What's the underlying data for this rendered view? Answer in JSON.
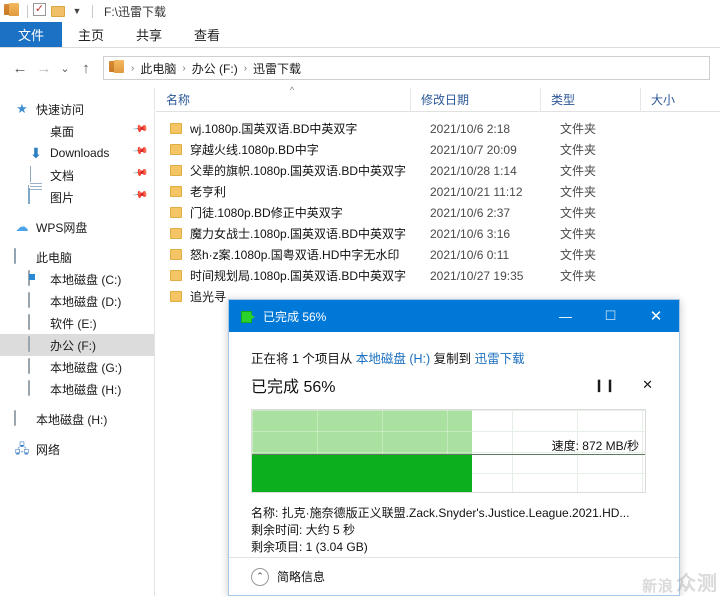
{
  "window": {
    "quick_access_icons": [
      "explorer-icon",
      "check-icon",
      "folder-icon",
      "dropdown-caret-icon"
    ],
    "title_path": "F:\\迅雷下载"
  },
  "ribbon": {
    "tabs": [
      {
        "label": "文件",
        "active": true
      },
      {
        "label": "主页",
        "active": false
      },
      {
        "label": "共享",
        "active": false
      },
      {
        "label": "查看",
        "active": false
      }
    ]
  },
  "address_bar": {
    "back_label": "←",
    "forward_label": "→",
    "history_label": "⌄",
    "up_label": "↑",
    "crumbs": [
      "此电脑",
      "办公 (F:)",
      "迅雷下载"
    ],
    "separator": "›"
  },
  "sidebar": {
    "items": [
      {
        "label": "快速访问",
        "icon": "star-icon",
        "level": 0,
        "pinned": false,
        "selected": false
      },
      {
        "label": "桌面",
        "icon": "desktop-icon",
        "level": 1,
        "pinned": true,
        "selected": false
      },
      {
        "label": "Downloads",
        "icon": "download-icon",
        "level": 1,
        "pinned": true,
        "selected": false
      },
      {
        "label": "文档",
        "icon": "document-icon",
        "level": 1,
        "pinned": true,
        "selected": false
      },
      {
        "label": "图片",
        "icon": "pictures-icon",
        "level": 1,
        "pinned": true,
        "selected": false
      },
      {
        "label": "WPS网盘",
        "icon": "cloud-icon",
        "level": 0,
        "pinned": false,
        "selected": false
      },
      {
        "label": "此电脑",
        "icon": "computer-icon",
        "level": 0,
        "pinned": false,
        "selected": false
      },
      {
        "label": "本地磁盘 (C:)",
        "icon": "windows-drive-icon",
        "level": 1,
        "pinned": false,
        "selected": false
      },
      {
        "label": "本地磁盘 (D:)",
        "icon": "drive-icon",
        "level": 1,
        "pinned": false,
        "selected": false
      },
      {
        "label": "软件 (E:)",
        "icon": "drive-icon",
        "level": 1,
        "pinned": false,
        "selected": false
      },
      {
        "label": "办公 (F:)",
        "icon": "drive-icon",
        "level": 1,
        "pinned": false,
        "selected": true
      },
      {
        "label": "本地磁盘 (G:)",
        "icon": "drive-icon",
        "level": 1,
        "pinned": false,
        "selected": false
      },
      {
        "label": "本地磁盘 (H:)",
        "icon": "drive-icon",
        "level": 1,
        "pinned": false,
        "selected": false
      },
      {
        "label": "本地磁盘 (H:)",
        "icon": "drive-icon",
        "level": 2,
        "pinned": false,
        "selected": false
      },
      {
        "label": "网络",
        "icon": "network-icon",
        "level": 2,
        "pinned": false,
        "selected": false
      }
    ]
  },
  "file_list": {
    "columns": [
      {
        "key": "name",
        "label": "名称"
      },
      {
        "key": "date",
        "label": "修改日期"
      },
      {
        "key": "type",
        "label": "类型"
      },
      {
        "key": "size",
        "label": "大小"
      }
    ],
    "sort_indicator": "^",
    "rows": [
      {
        "name": "wj.1080p.国英双语.BD中英双字",
        "date": "2021/10/6 2:18",
        "type": "文件夹",
        "size": ""
      },
      {
        "name": "穿越火线.1080p.BD中字",
        "date": "2021/10/7 20:09",
        "type": "文件夹",
        "size": ""
      },
      {
        "name": "父辈的旗帜.1080p.国英双语.BD中英双字",
        "date": "2021/10/28 1:14",
        "type": "文件夹",
        "size": ""
      },
      {
        "name": "老亨利",
        "date": "2021/10/21 11:12",
        "type": "文件夹",
        "size": ""
      },
      {
        "name": "门徒.1080p.BD修正中英双字",
        "date": "2021/10/6 2:37",
        "type": "文件夹",
        "size": ""
      },
      {
        "name": "魔力女战士.1080p.国英双语.BD中英双字",
        "date": "2021/10/6 3:16",
        "type": "文件夹",
        "size": ""
      },
      {
        "name": "怒h·z案.1080p.国粤双语.HD中字无水印",
        "date": "2021/10/6 0:11",
        "type": "文件夹",
        "size": ""
      },
      {
        "name": "时间规划局.1080p.国英双语.BD中英双字",
        "date": "2021/10/27 19:35",
        "type": "文件夹",
        "size": ""
      },
      {
        "name": "追光寻",
        "date": "",
        "type": "",
        "size": ""
      }
    ]
  },
  "copy_dialog": {
    "title": "已完成 56%",
    "title_icon": "copy-icon",
    "minimize_label": "—",
    "maximize_label": "☐",
    "close_label": "✕",
    "copy_line": {
      "prefix": "正在将 1 个项目从 ",
      "source": "本地磁盘 (H:)",
      "middle": " 复制到 ",
      "destination": "迅雷下载"
    },
    "percent_text": "已完成 56%",
    "percent_value": 56,
    "pause_label": "❙❙",
    "cancel_label": "✕",
    "speed_label": "速度: 872 MB/秒",
    "name_line": "名称: 扎克·施奈德版正义联盟.Zack.Snyder's.Justice.League.2021.HD...",
    "time_line": "剩余时间: 大约 5 秒",
    "items_line": "剩余项目: 1 (3.04 GB)",
    "footer_label": "简略信息",
    "footer_chevron": "⌃",
    "accent_color": "#0078d7",
    "bar_color": "#0cb01e",
    "area_color": "#a6df9b"
  },
  "watermark": {
    "line1": "新浪",
    "line2": "众测"
  }
}
